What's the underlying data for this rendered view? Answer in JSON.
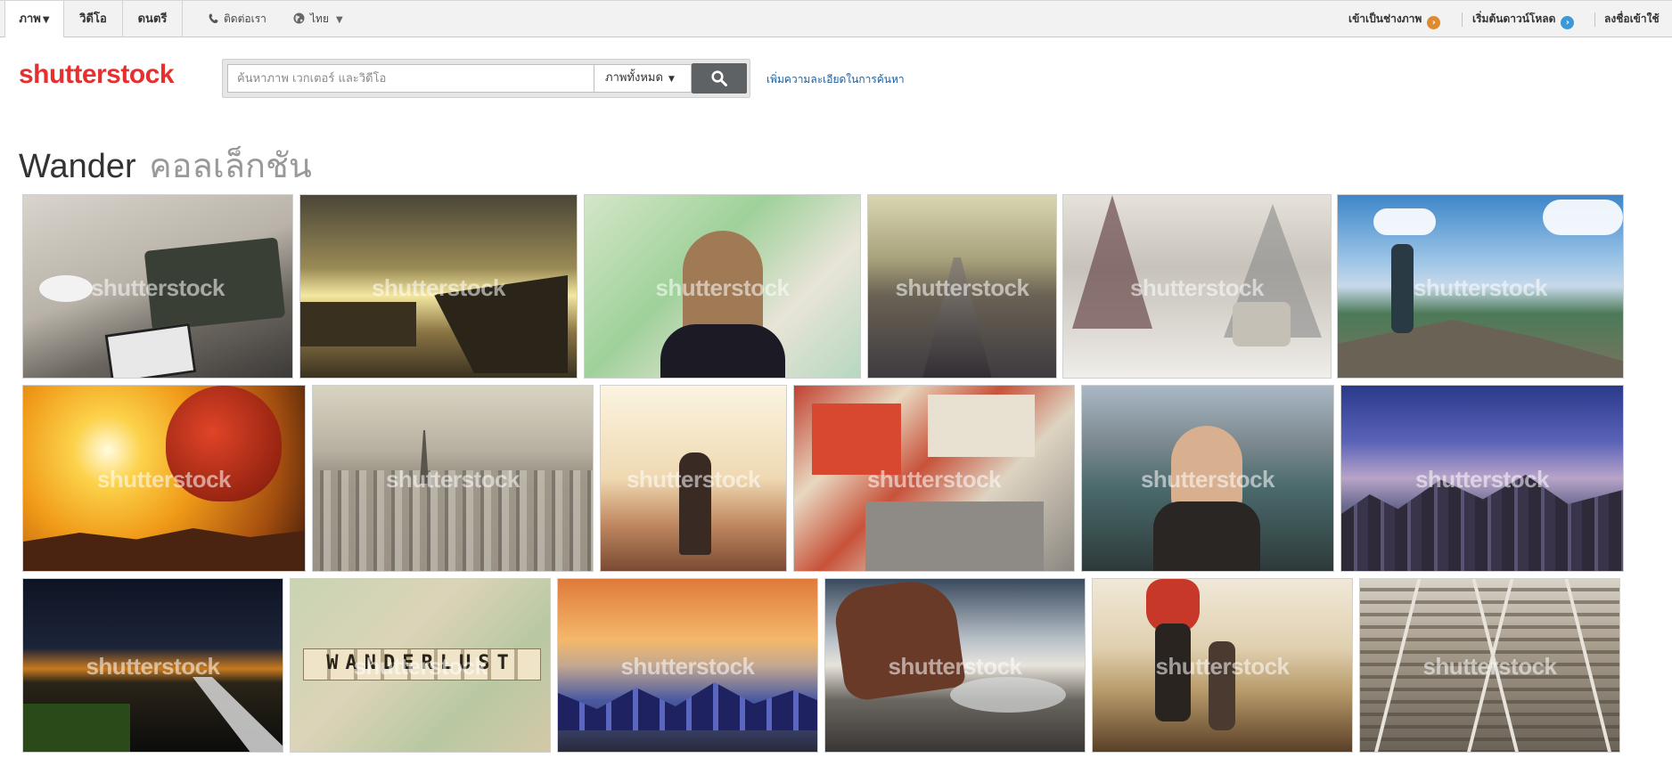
{
  "topbar": {
    "tabs": [
      {
        "label": "ภาพ",
        "active": true,
        "caret": "▼"
      },
      {
        "label": "วิดีโอ",
        "active": false
      },
      {
        "label": "ดนตรี",
        "active": false
      }
    ],
    "contact": {
      "label": "ติดต่อเรา",
      "icon": "phone-icon"
    },
    "language": {
      "label": "ไทย",
      "icon": "globe-icon",
      "caret": "▼"
    },
    "right_links": [
      {
        "label": "เข้าเป็นช่างภาพ",
        "icon": "chevron-right-circle-icon",
        "color": "#e08a2e"
      },
      {
        "label": "เริ่มต้นดาวน์โหลด",
        "icon": "chevron-right-circle-icon",
        "color": "#3a9ad9"
      },
      {
        "label": "ลงชื่อเข้าใช้"
      }
    ]
  },
  "header": {
    "logo": "shutterstock",
    "search": {
      "placeholder": "ค้นหาภาพ เวกเตอร์ และวิดีโอ",
      "value": "",
      "type_selected": "ภาพทั้งหมด",
      "button_icon": "search-icon"
    },
    "refine_link": "เพิ่มความละเอียดในการค้นหา"
  },
  "page": {
    "title_main": "Wander",
    "title_suffix": "คอลเล็กชัน"
  },
  "gallery": {
    "watermark": "shutterstock",
    "images": [
      {
        "subject": "vintage suitcase and tablet on table"
      },
      {
        "subject": "kids jumping off boat at sunset"
      },
      {
        "subject": "woman looking at map"
      },
      {
        "subject": "blurred highway road"
      },
      {
        "subject": "snowy forest road with car"
      },
      {
        "subject": "hiker on mountain peak"
      },
      {
        "subject": "hot air balloon at sunrise"
      },
      {
        "subject": "Paris skyline with Eiffel tower"
      },
      {
        "subject": "woman silhouette in fog"
      },
      {
        "subject": "Prague old town square aerial"
      },
      {
        "subject": "woman selfie over town river"
      },
      {
        "subject": "city skyline at dusk"
      },
      {
        "subject": "night lake with pier"
      },
      {
        "subject": "wanderlust tiles on map"
      },
      {
        "subject": "Venice gondolas at sunset"
      },
      {
        "subject": "rock on seashore long exposure"
      },
      {
        "subject": "hikers walking on trail"
      },
      {
        "subject": "railway tracks crossing"
      }
    ]
  }
}
